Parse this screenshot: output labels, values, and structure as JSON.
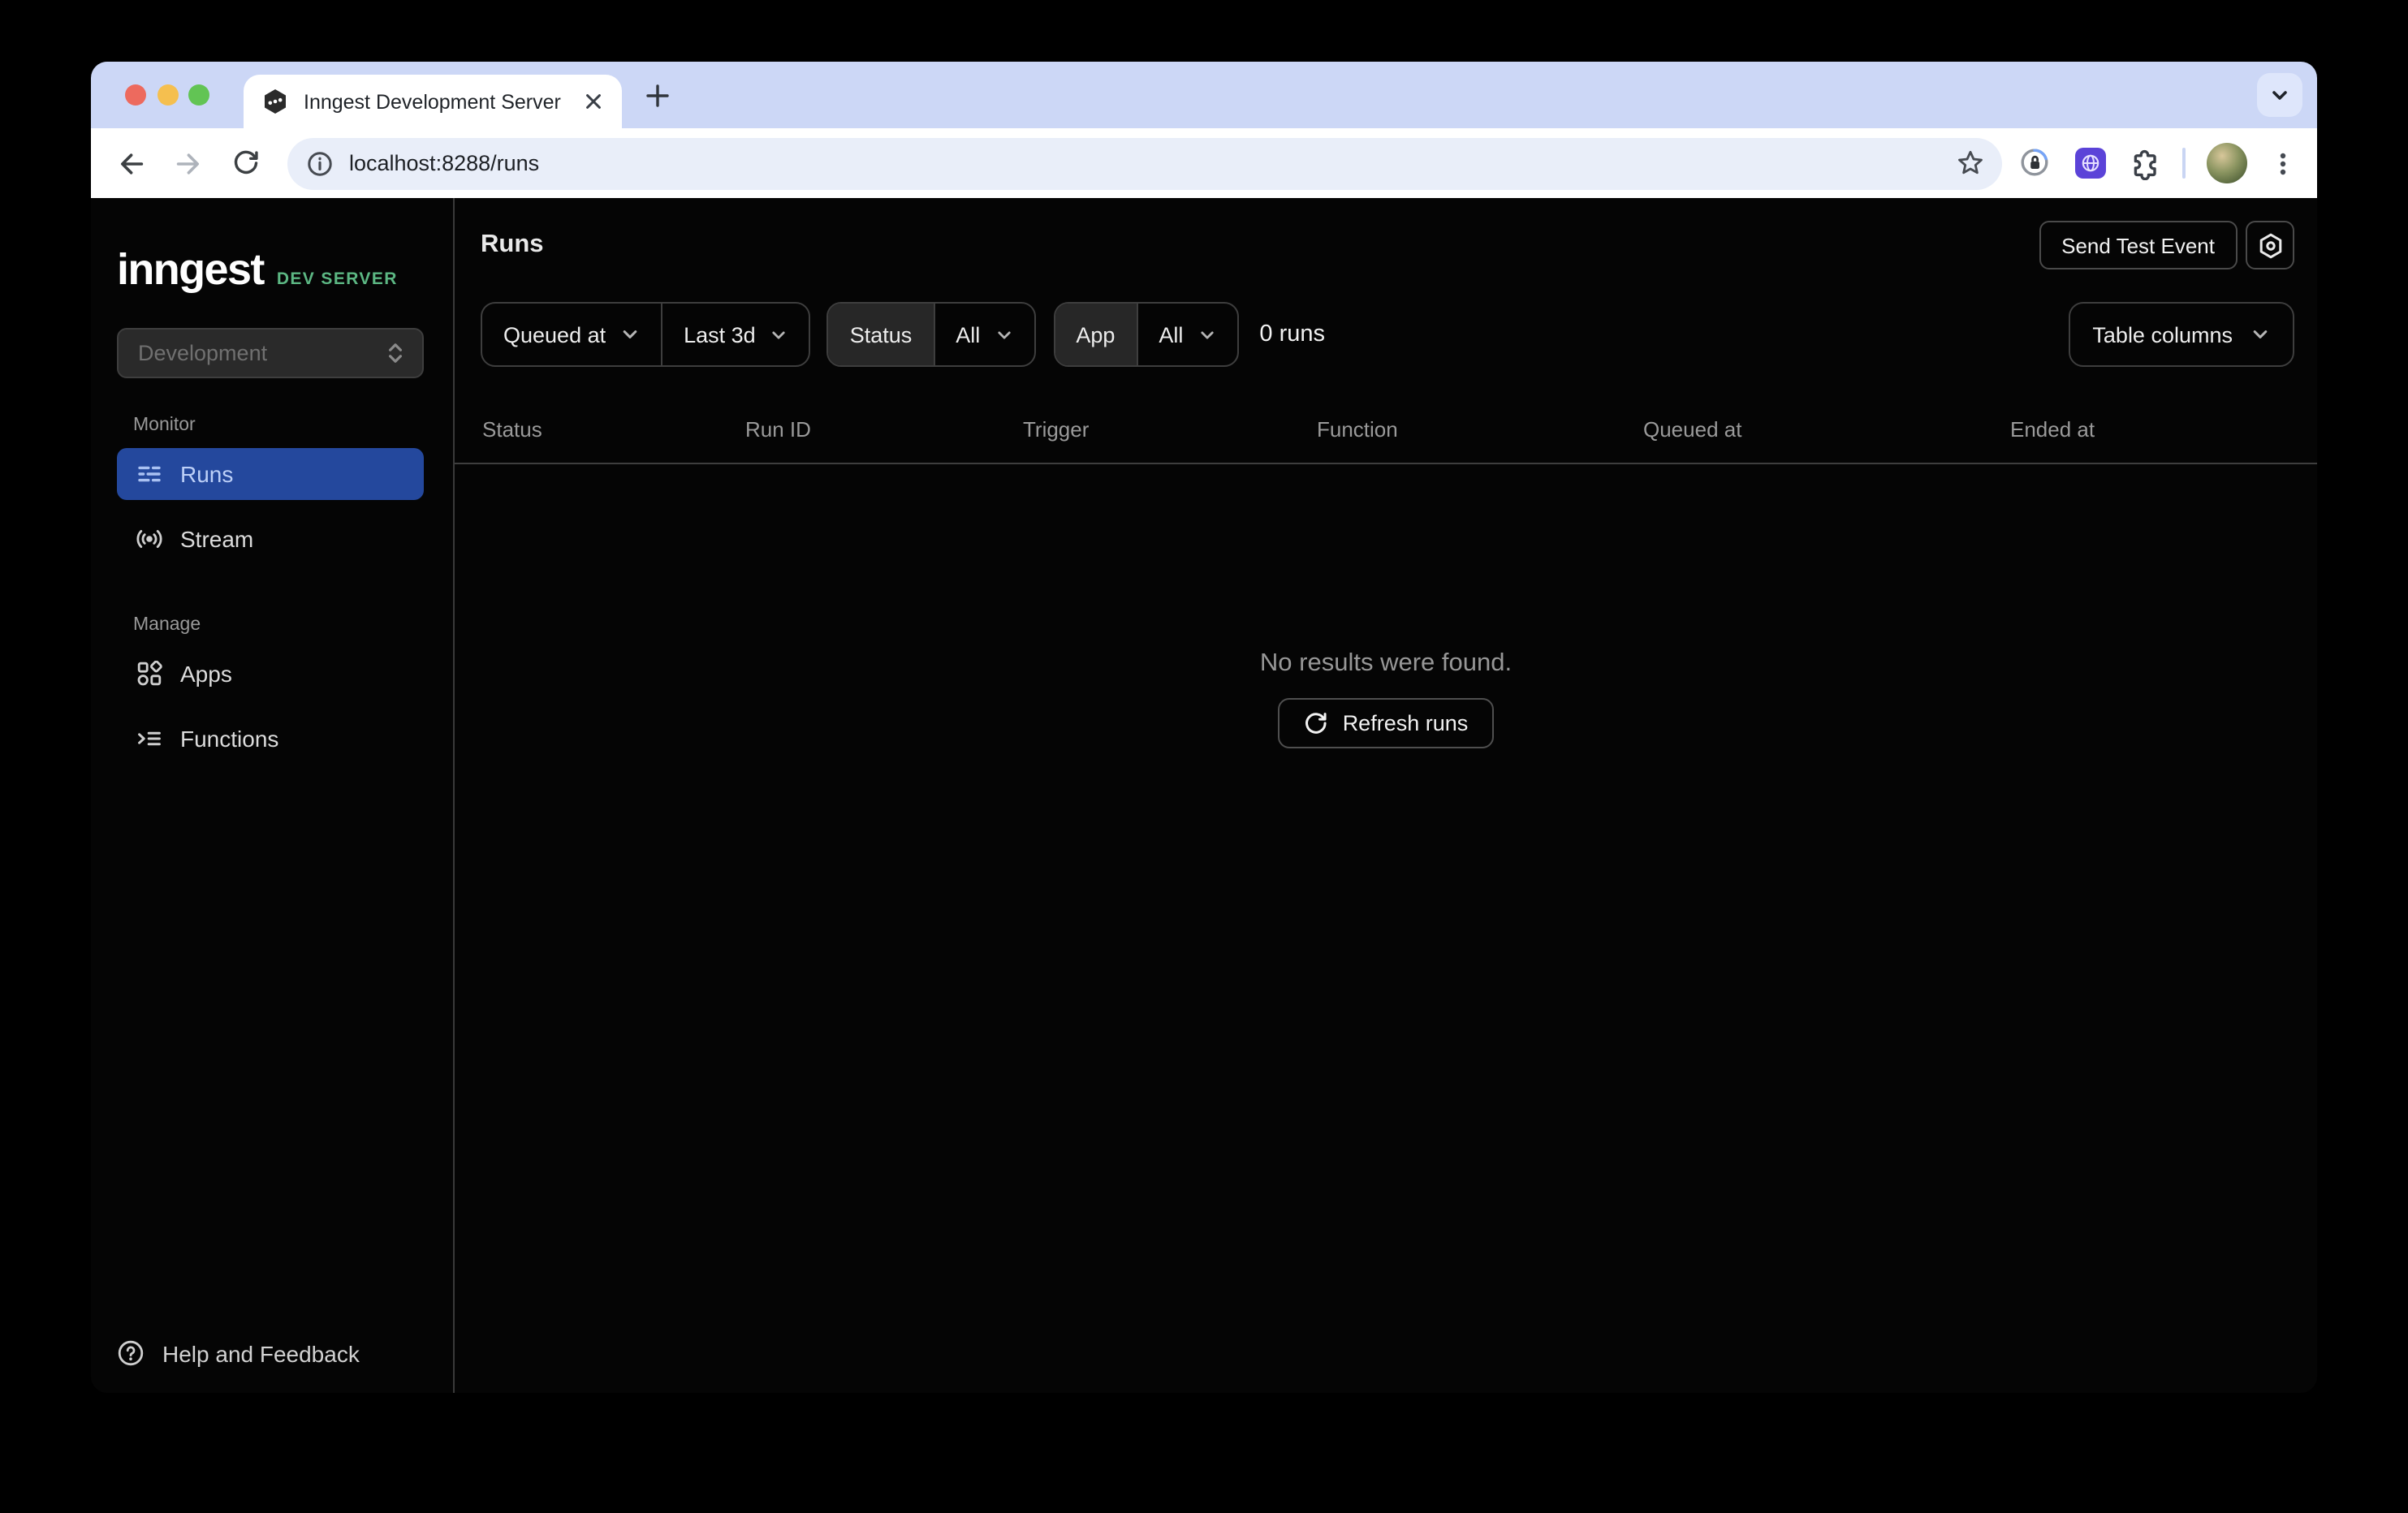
{
  "browser": {
    "tab_title": "Inngest Development Server",
    "url": "localhost:8288/runs"
  },
  "sidebar": {
    "logo": "inngest",
    "env_badge": "DEV SERVER",
    "environment": "Development",
    "sections": [
      {
        "label": "Monitor",
        "items": [
          {
            "label": "Runs",
            "icon": "runs-list-icon",
            "active": true
          },
          {
            "label": "Stream",
            "icon": "broadcast-icon",
            "active": false
          }
        ]
      },
      {
        "label": "Manage",
        "items": [
          {
            "label": "Apps",
            "icon": "apps-grid-icon",
            "active": false
          },
          {
            "label": "Functions",
            "icon": "functions-list-icon",
            "active": false
          }
        ]
      }
    ],
    "footer_label": "Help and Feedback"
  },
  "header": {
    "title": "Runs",
    "send_test_event_label": "Send Test Event",
    "settings_icon": "gear-icon"
  },
  "filters": {
    "time_field": "Queued at",
    "time_range": "Last 3d",
    "status_label": "Status",
    "status_value": "All",
    "app_label": "App",
    "app_value": "All",
    "runs_count": "0 runs",
    "table_columns_label": "Table columns"
  },
  "table": {
    "columns": [
      "Status",
      "Run ID",
      "Trigger",
      "Function",
      "Queued at",
      "Ended at"
    ]
  },
  "empty_state": {
    "message": "No results were found.",
    "refresh_label": "Refresh runs"
  },
  "colors": {
    "accent_blue": "#24489d",
    "brand_green": "#5cb783",
    "tab_strip": "#ccd7f6",
    "app_background": "#050505",
    "border_gray": "#3e3e3e"
  }
}
